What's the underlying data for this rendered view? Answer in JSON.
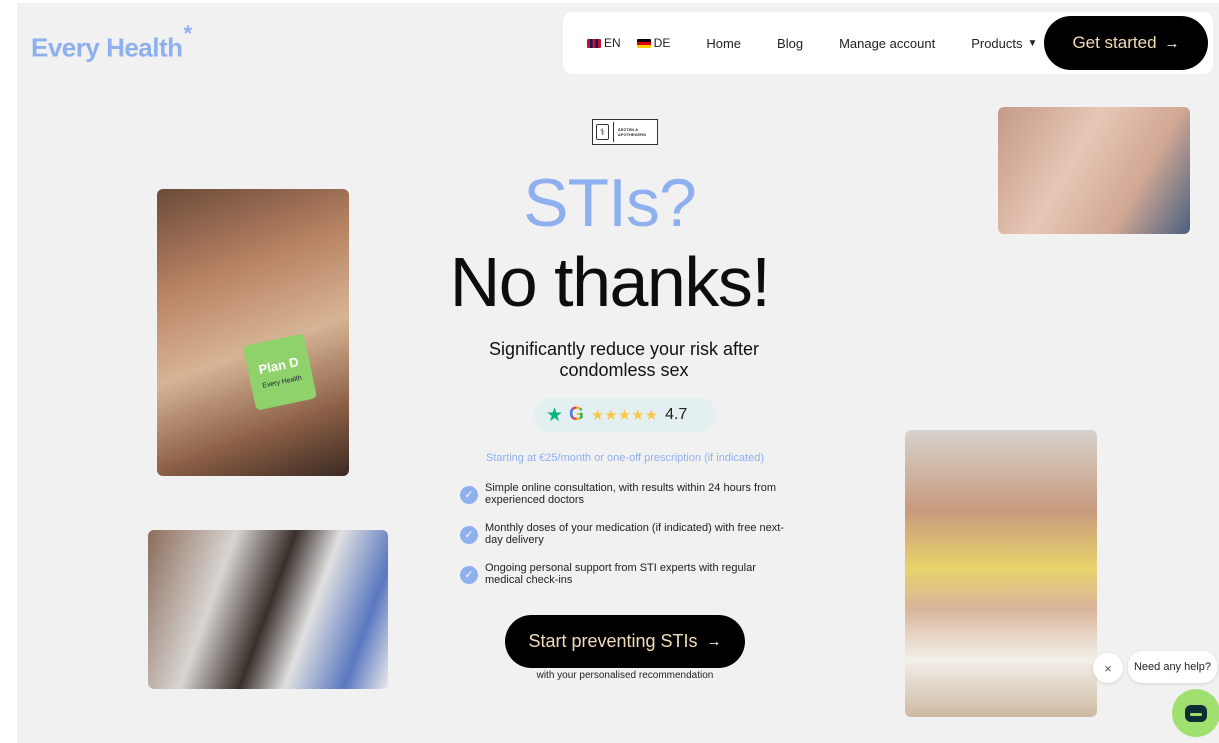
{
  "brand": {
    "logo_text": "Every Health",
    "logo_mark": "*",
    "accent": "#8fb0ef"
  },
  "nav": {
    "languages": [
      {
        "code": "EN",
        "flag": "uk-flag"
      },
      {
        "code": "DE",
        "flag": "de-flag"
      }
    ],
    "links": {
      "home": "Home",
      "blog": "Blog",
      "manage": "Manage account",
      "products": "Products"
    },
    "cta": "Get started",
    "arrow": "→",
    "chevron": "⌄"
  },
  "badge": {
    "text": "ÄRZTEN & APOTHEKERN"
  },
  "hero": {
    "headline_1": "STIs?",
    "headline_2": "No thanks!",
    "subhead": "Significantly reduce your risk after condomless sex",
    "rating": {
      "stars": "★★★★★",
      "score": "4.7",
      "trust_star": "★",
      "google_letter": "G"
    },
    "price_note": "Starting at €25/month or one-off prescription (if indicated)",
    "features": [
      "Simple online consultation, with results within 24 hours from experienced doctors",
      "Monthly doses of your medication (if indicated) with free next-day delivery",
      "Ongoing personal support from STI experts with regular medical check-ins"
    ],
    "cta": "Start preventing STIs",
    "cta_sub": "with your personalised recommendation"
  },
  "product_pack": {
    "name": "Plan D",
    "brand": "Every Health"
  },
  "chat": {
    "close": "×",
    "prompt": "Need any help?"
  },
  "colors": {
    "cta_bg": "#000000",
    "cta_text": "#f3dcb8",
    "chat_button": "#9fe06e",
    "page_bg": "#f1f1f1"
  }
}
